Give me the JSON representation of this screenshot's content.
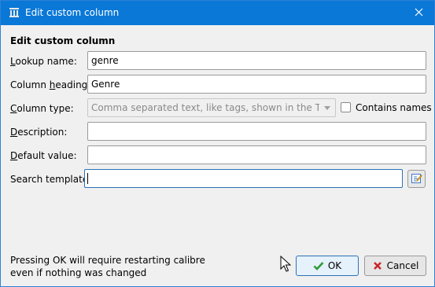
{
  "window": {
    "title": "Edit custom column",
    "app_icon": "library-icon",
    "close_icon": "close-icon"
  },
  "form": {
    "heading": "Edit custom column",
    "lookup_name": {
      "label": "Lookup name:",
      "value": "genre"
    },
    "column_heading": {
      "label": "Column heading:",
      "value": "Genre"
    },
    "column_type": {
      "label": "Column type:",
      "selected": "Comma separated text, like tags, shown in the Tag browser"
    },
    "contains_names": {
      "label": "Contains names",
      "checked": false
    },
    "description": {
      "label": "Description:",
      "value": ""
    },
    "default_value": {
      "label": "Default value:",
      "value": ""
    },
    "search_template": {
      "label": "Search template:",
      "value": "",
      "edit_icon": "edit-template-icon"
    }
  },
  "footer": {
    "note_line1": "Pressing OK will require restarting calibre",
    "note_line2": "even if nothing was changed",
    "ok_label": "OK",
    "cancel_label": "Cancel"
  },
  "colors": {
    "titlebar": "#0a78d7",
    "focus_border": "#2b73b6",
    "ok_check": "#2e9b3a",
    "cancel_x": "#c8282d"
  }
}
